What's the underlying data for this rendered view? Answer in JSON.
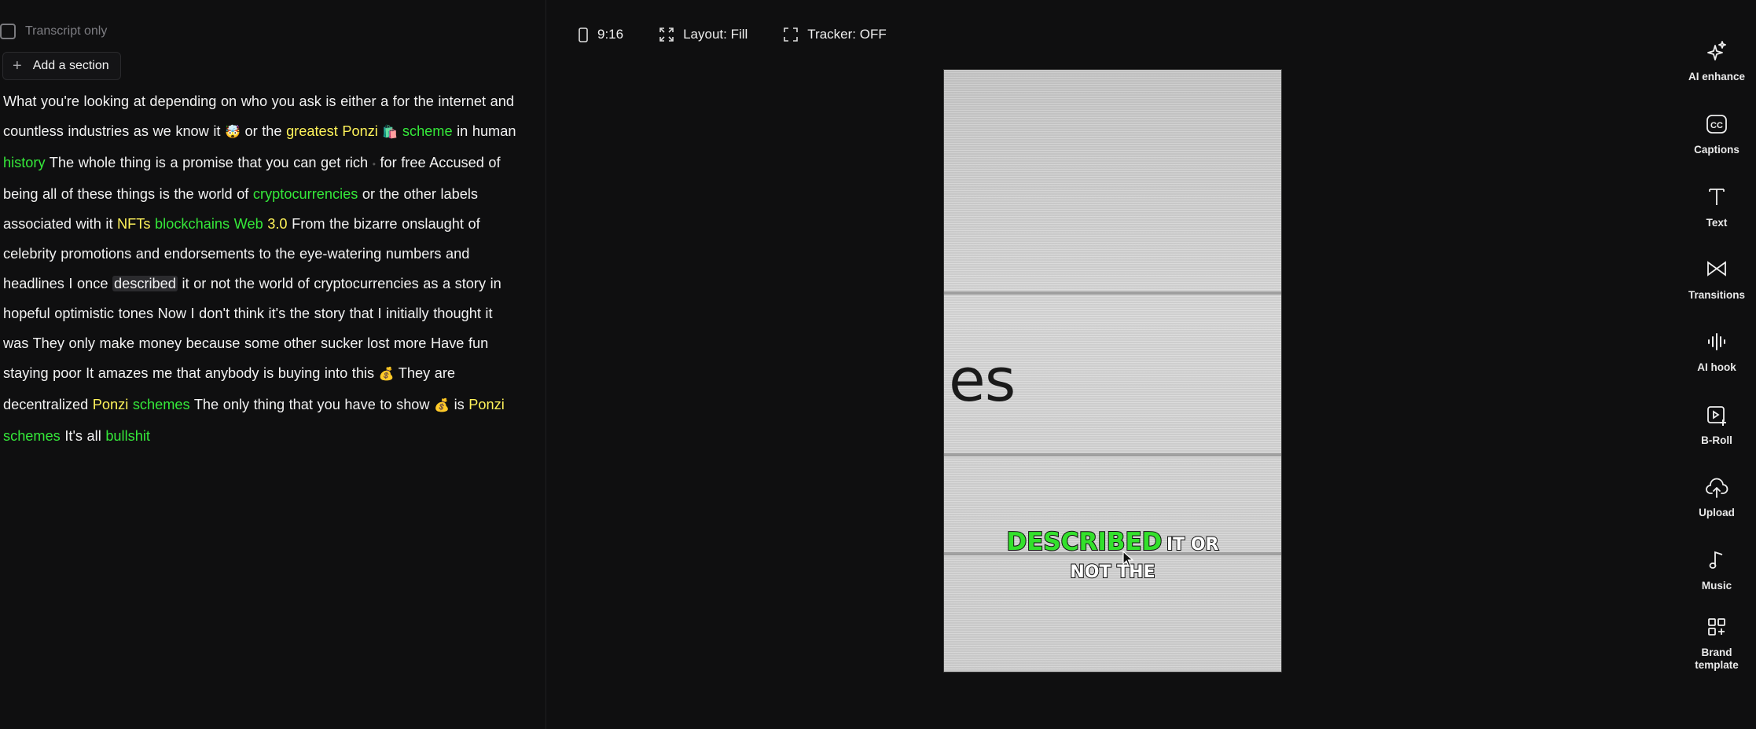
{
  "transcript_only": {
    "label": "Transcript only",
    "checked": false
  },
  "add_section": {
    "label": "Add a section"
  },
  "toolbar": {
    "aspect": "9:16",
    "layout": "Layout: Fill",
    "tracker": "Tracker: OFF"
  },
  "transcript": {
    "segments": [
      {
        "t": "What you're looking at depending on who you ask is either a for the internet and countless industries as we know it "
      },
      {
        "t": "🤯",
        "c": "emoji"
      },
      {
        "t": "  or the "
      },
      {
        "t": "greatest Ponzi",
        "c": "w-y"
      },
      {
        "t": " "
      },
      {
        "t": "🛍️",
        "c": "emoji"
      },
      {
        "t": " "
      },
      {
        "t": "scheme",
        "c": "w-g"
      },
      {
        "t": " in human "
      },
      {
        "t": "history",
        "c": "w-g"
      },
      {
        "t": " The whole thing is a promise that you can get rich  "
      },
      {
        "t": "•",
        "c": "dot"
      },
      {
        "t": "  for free Accused of being all of these things is the world of "
      },
      {
        "t": "cryptocurrencies",
        "c": "w-g"
      },
      {
        "t": " or the other labels associated with it "
      },
      {
        "t": "NFTs",
        "c": "w-y"
      },
      {
        "t": " "
      },
      {
        "t": "blockchains Web",
        "c": "w-g"
      },
      {
        "t": " "
      },
      {
        "t": "3.0",
        "c": "w-y"
      },
      {
        "t": " From the bizarre onslaught of celebrity promotions and endorsements to the eye-watering numbers and headlines I once "
      },
      {
        "t": "described",
        "c": "w-hl"
      },
      {
        "t": " it or not the world of cryptocurrencies as a story in hopeful optimistic tones Now I don't think it's the story that I initially thought it was They only make money because some other sucker lost more Have fun staying poor It amazes me that anybody is buying into this "
      },
      {
        "t": "💰",
        "c": "emoji"
      },
      {
        "t": "  They are decentralized "
      },
      {
        "t": "Ponzi",
        "c": "w-y"
      },
      {
        "t": " "
      },
      {
        "t": "schemes",
        "c": "w-g"
      },
      {
        "t": " The only thing that you have to show "
      },
      {
        "t": "💰",
        "c": "emoji"
      },
      {
        "t": "  is "
      },
      {
        "t": "Ponzi",
        "c": "w-y"
      },
      {
        "t": " "
      },
      {
        "t": "schemes",
        "c": "w-g"
      },
      {
        "t": " It's all "
      },
      {
        "t": "bullshit",
        "c": "w-g"
      }
    ]
  },
  "preview": {
    "background_text": "es",
    "caption": {
      "highlight": "DESCRIBED",
      "rest_line1": "IT OR",
      "line2": "NOT THE"
    },
    "highlight_color": "#33e02c"
  },
  "tools": [
    {
      "label": "AI enhance",
      "icon": "sparkles-icon"
    },
    {
      "label": "Captions",
      "icon": "cc-icon"
    },
    {
      "label": "Text",
      "icon": "text-icon"
    },
    {
      "label": "Transitions",
      "icon": "transitions-icon"
    },
    {
      "label": "AI hook",
      "icon": "waveform-icon"
    },
    {
      "label": "B-Roll",
      "icon": "broll-icon"
    },
    {
      "label": "Upload",
      "icon": "upload-cloud-icon"
    },
    {
      "label": "Music",
      "icon": "music-note-icon"
    },
    {
      "label": "Brand\ntemplate",
      "icon": "brand-template-icon"
    }
  ]
}
